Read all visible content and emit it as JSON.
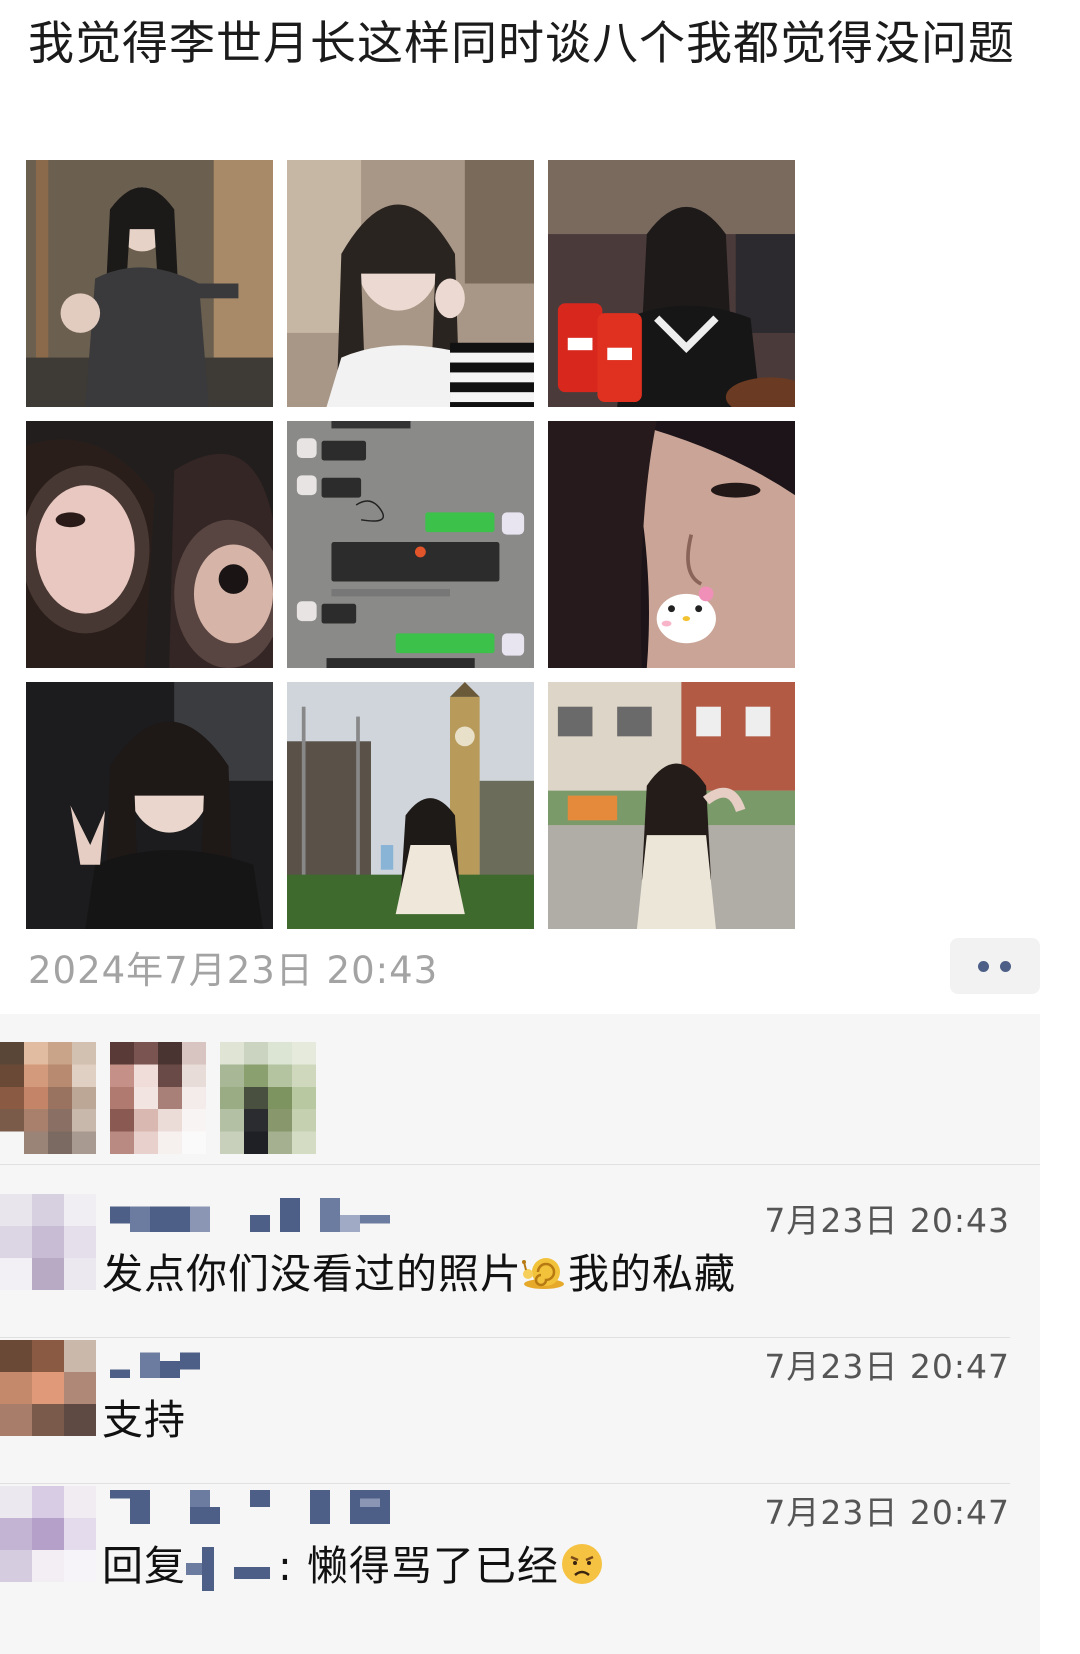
{
  "post": {
    "text": "我觉得李世月长这样同时谈八个我都觉得没问题",
    "timestamp": "2024年7月23日 20:43",
    "more_button_icon": "ellipsis-icon"
  },
  "photos": [
    {
      "scene": "selfie-gray-cardigan-doorway"
    },
    {
      "scene": "selfie-striped-sweater-cafe"
    },
    {
      "scene": "selfie-holding-coke-cans-restaurant"
    },
    {
      "scene": "closeup-two-faces"
    },
    {
      "scene": "chat-screenshot"
    },
    {
      "scene": "closeup-face-with-kitty-sticker"
    },
    {
      "scene": "selfie-peace-sign-in-car"
    },
    {
      "scene": "sitting-on-grass-big-ben"
    },
    {
      "scene": "street-portrait-london"
    }
  ],
  "likes": {
    "avatars": [
      "blurred-avatar-1",
      "blurred-avatar-2",
      "blurred-avatar-3"
    ]
  },
  "comments": [
    {
      "time": "7月23日 20:43",
      "text": "发点你们没看过的照片",
      "emoji": "snail-emoji",
      "text_after": "我的私藏"
    },
    {
      "time": "7月23日 20:47",
      "text": "支持"
    },
    {
      "time": "7月23日 20:47",
      "reply_prefix": "回复",
      "reply_suffix": ": 懒得骂了已经",
      "emoji": "frowning-face-emoji"
    }
  ],
  "colors": {
    "timestamp": "#a3a3a3",
    "comments_bg": "#f6f6f6",
    "name_blue": "#4d5f86",
    "chat_green": "#3cc24a"
  }
}
